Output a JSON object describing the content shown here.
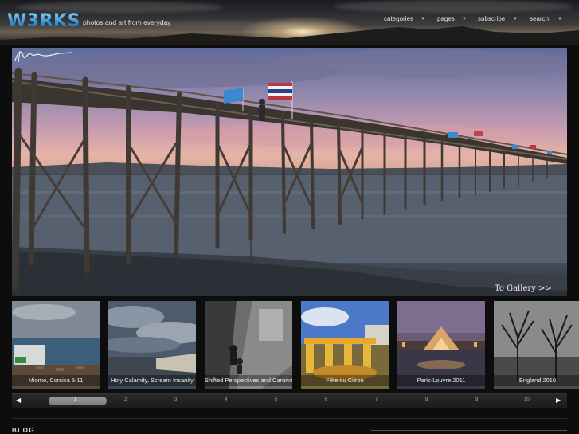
{
  "site": {
    "logo": "W3RKS",
    "tagline": "photos and art from everyday"
  },
  "nav": {
    "items": [
      {
        "label": "categories",
        "icon": "chevron-down-icon"
      },
      {
        "label": "pages",
        "icon": "chevron-down-icon"
      },
      {
        "label": "subscribe",
        "icon": "chevron-down-icon"
      },
      {
        "label": "search",
        "icon": "chevron-down-icon"
      }
    ]
  },
  "hero": {
    "link_label": "To Gallery >>",
    "colors": {
      "sky_top": "#5f6b9a",
      "sky_pink": "#e7b3a7",
      "water": "#4b5868",
      "flag_blue": "#3a8ad0",
      "flag_thai_red": "#c0343c"
    }
  },
  "galleries": [
    {
      "caption": "Miomo, Corsica 5-11"
    },
    {
      "caption": "Holy Calamity, Scream Insanity"
    },
    {
      "caption": "Shifted Perspectives and Carnival"
    },
    {
      "caption": "Fête du Citron"
    },
    {
      "caption": "Paris-Louvre 2011"
    },
    {
      "caption": "England 2010"
    }
  ],
  "pager": {
    "prev_icon": "triangle-left-icon",
    "next_icon": "triangle-right-icon",
    "pages": [
      "1",
      "2",
      "3",
      "4",
      "5",
      "6",
      "7",
      "8",
      "9",
      "10"
    ],
    "current": "1"
  },
  "blog": {
    "heading": "BLOG"
  }
}
